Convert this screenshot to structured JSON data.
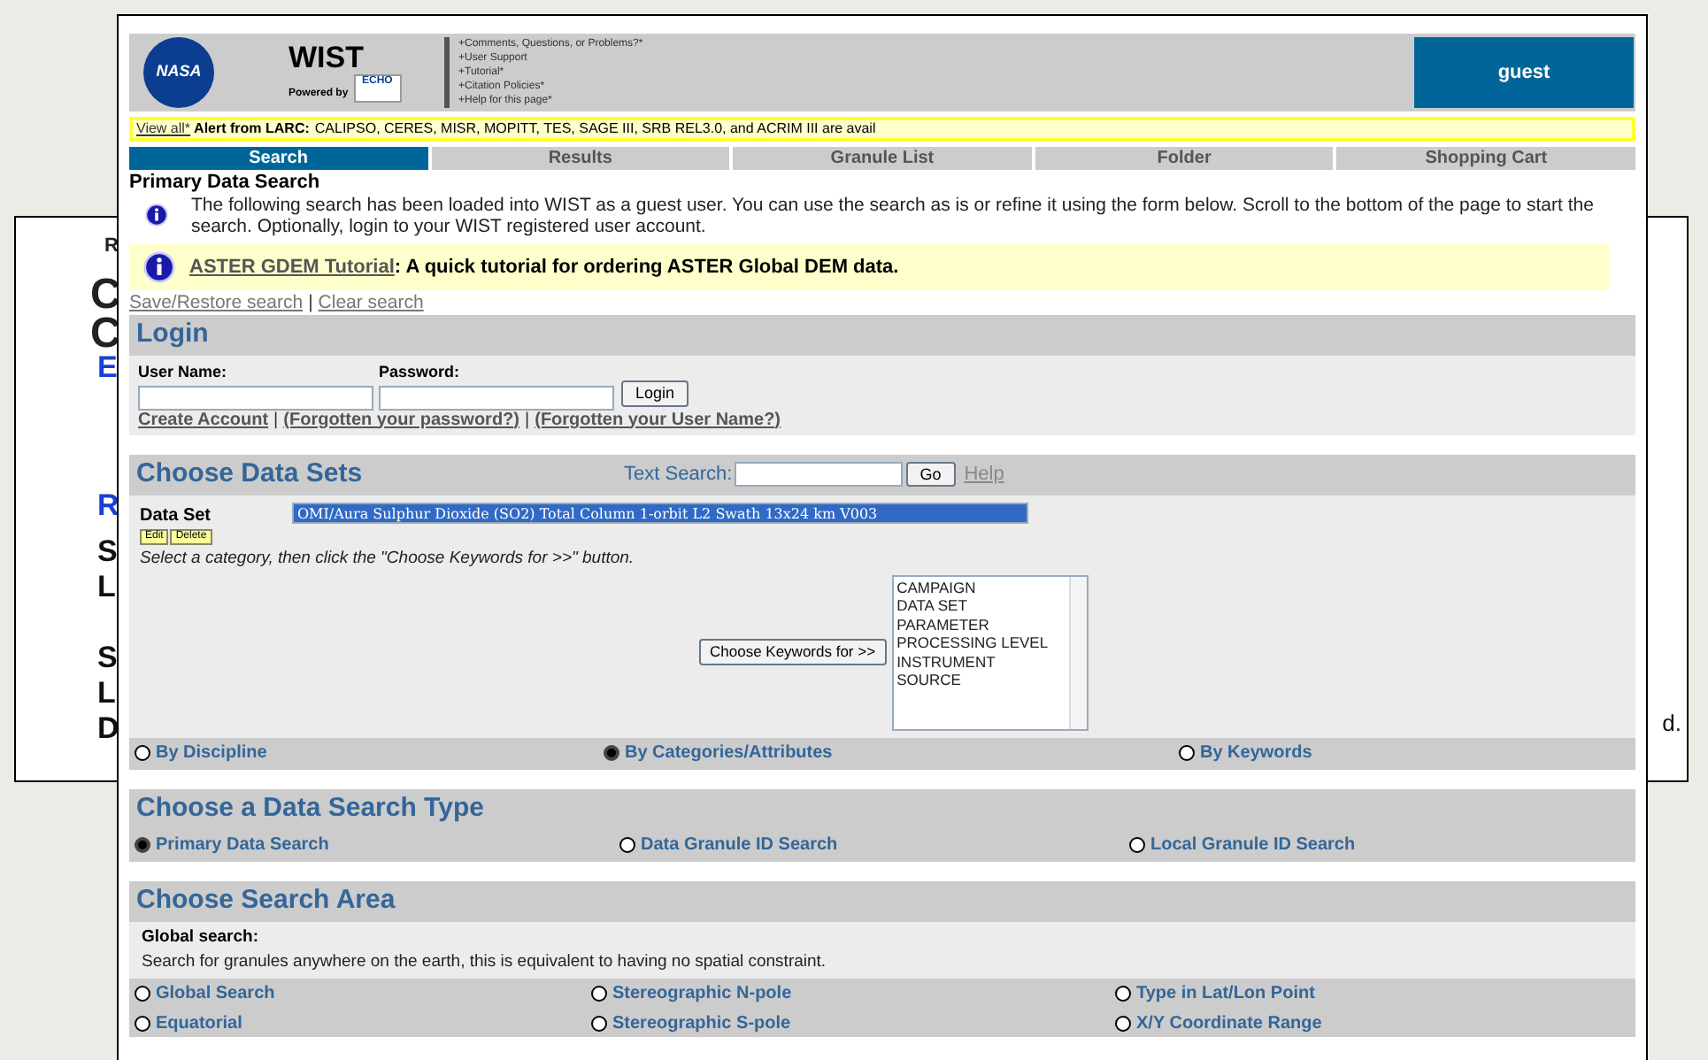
{
  "background_window": {
    "fragments": [
      {
        "text": "R",
        "kind": "small"
      },
      {
        "text": "C",
        "kind": "large"
      },
      {
        "text": "C",
        "kind": "large"
      },
      {
        "text": "E",
        "kind": "link"
      },
      {
        "text": "R",
        "kind": "link"
      },
      {
        "text": "S",
        "kind": "bold"
      },
      {
        "text": "L",
        "kind": "bold"
      },
      {
        "text": "S",
        "kind": "bold"
      },
      {
        "text": "L",
        "kind": "bold"
      },
      {
        "text": "D",
        "kind": "bold"
      }
    ],
    "right_text": "d."
  },
  "header": {
    "logo_text": "NASA",
    "title": "WIST",
    "powered_by": "Powered by",
    "echo_text": "ECHO",
    "links": [
      "+Comments, Questions, or Problems?*",
      "+User Support",
      "+Tutorial*",
      "+Citation Policies*",
      "+Help for this page*"
    ],
    "user": "guest"
  },
  "alert": {
    "link": "View all*",
    "label": "Alert from LARC:",
    "text": "CALIPSO, CERES, MISR, MOPITT, TES, SAGE III, SRB REL3.0, and ACRIM III are avail"
  },
  "tabs": [
    {
      "label": "Search",
      "selected": true
    },
    {
      "label": "Results",
      "selected": false
    },
    {
      "label": "Granule List",
      "selected": false
    },
    {
      "label": "Folder",
      "selected": false
    },
    {
      "label": "Shopping Cart",
      "selected": false
    }
  ],
  "page_title": "Primary Data Search",
  "notice": "The following search has been loaded into WIST as a guest user. You can use the search as is or refine it using the form below. Scroll to the bottom of the page to start the search. Optionally, login to your WIST registered user account.",
  "tutorial": {
    "link": "ASTER GDEM Tutorial",
    "text": ": A quick tutorial for ordering ASTER Global DEM data."
  },
  "search_links": [
    "Save/Restore search",
    "Clear search"
  ],
  "link_separator": "|",
  "login": {
    "title": "Login",
    "fields": [
      {
        "label": "User Name:"
      },
      {
        "label": "Password:"
      }
    ],
    "button": "Login",
    "links": [
      "Create Account",
      "(Forgotten your password?)",
      "(Forgotten your User Name?)"
    ]
  },
  "data_sets": {
    "title": "Choose Data Sets",
    "text_search_label": "Text Search:",
    "go_button": "Go",
    "help_link": "Help",
    "data_set_label": "Data Set",
    "edit_button": "Edit",
    "delete_button": "Delete",
    "selected_dataset": "OMI/Aura Sulphur Dioxide (SO2) Total Column 1-orbit L2 Swath 13x24 km V003",
    "instruction": "Select a category, then click the \"Choose Keywords for >>\" button.",
    "keywords_button": "Choose Keywords for >>",
    "categories": [
      "CAMPAIGN",
      "DATA SET",
      "PARAMETER",
      "PROCESSING LEVEL",
      "INSTRUMENT",
      "SOURCE"
    ],
    "modes": [
      {
        "label": "By Discipline",
        "selected": false
      },
      {
        "label": "By Categories/Attributes",
        "selected": true
      },
      {
        "label": "By Keywords",
        "selected": false
      }
    ]
  },
  "search_type": {
    "title": "Choose a Data Search Type",
    "options": [
      {
        "label": "Primary Data Search",
        "selected": true
      },
      {
        "label": "Data Granule ID Search",
        "selected": false
      },
      {
        "label": "Local Granule ID Search",
        "selected": false
      }
    ]
  },
  "search_area": {
    "title": "Choose Search Area",
    "note_title": "Global search:",
    "note_text": "Search for granules anywhere on the earth, this is equivalent to having no spatial constraint.",
    "options": [
      {
        "label": "Global Search",
        "selected": false
      },
      {
        "label": "Stereographic N-pole",
        "selected": false
      },
      {
        "label": "Type in Lat/Lon Point",
        "selected": false
      },
      {
        "label": "Equatorial",
        "selected": false
      },
      {
        "label": "Stereographic S-pole",
        "selected": false
      },
      {
        "label": "X/Y Coordinate Range",
        "selected": false
      }
    ]
  }
}
